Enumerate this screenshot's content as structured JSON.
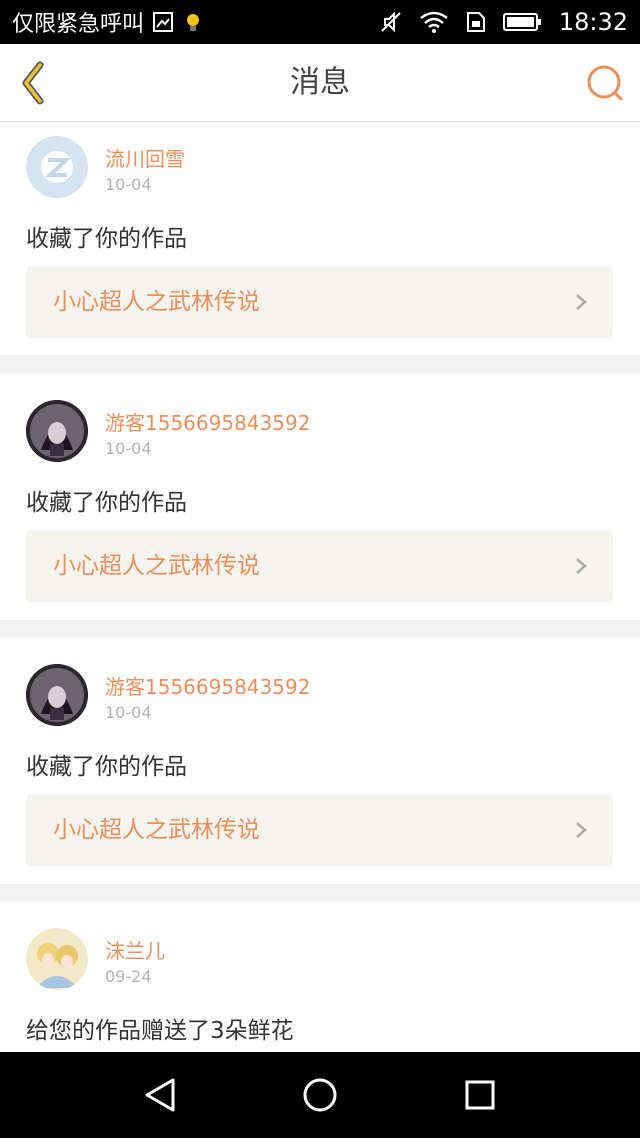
{
  "status_bar": {
    "carrier": "仅限紧急呼叫",
    "time": "18:32"
  },
  "header": {
    "title": "消息"
  },
  "messages": [
    {
      "username": "流川回雪",
      "date": "10-04",
      "action": "收藏了你的作品",
      "work_title": "小心超人之武林传说"
    },
    {
      "username": "游客1556695843592",
      "date": "10-04",
      "action": "收藏了你的作品",
      "work_title": "小心超人之武林传说"
    },
    {
      "username": "游客1556695843592",
      "date": "10-04",
      "action": "收藏了你的作品",
      "work_title": "小心超人之武林传说"
    },
    {
      "username": "沫兰儿",
      "date": "09-24",
      "action": "给您的作品赠送了3朵鲜花"
    }
  ],
  "colors": {
    "accent": "#ee8f5a",
    "back_icon": "#c9a21a",
    "card_link_bg": "#f5f4ef"
  },
  "icons": [
    "back-chevron-icon",
    "search-icon",
    "chevron-right-icon",
    "back-triangle-icon",
    "home-circle-icon",
    "recents-square-icon"
  ]
}
